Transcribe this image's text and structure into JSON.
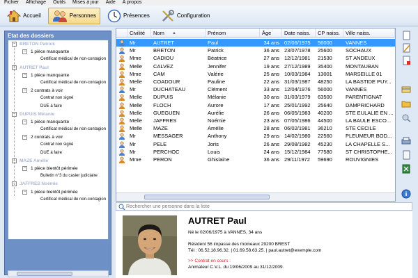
{
  "menu": [
    "Fichier",
    "Affichage",
    "Outils",
    "Mises à jour",
    "Aide",
    "A propos"
  ],
  "toolbar": [
    {
      "label": "Accueil",
      "icon": "home-icon",
      "active": false
    },
    {
      "label": "Personnes",
      "icon": "people-icon",
      "active": true
    },
    {
      "label": "Présences",
      "icon": "clock-icon",
      "active": false
    },
    {
      "label": "Configuration",
      "icon": "tools-icon",
      "active": false
    }
  ],
  "left_panel": {
    "title": "Etat des dossiers",
    "tree": [
      {
        "level": 0,
        "text": "BRETON Patrick",
        "blur": true
      },
      {
        "level": 1,
        "text": "1 pièce manquante"
      },
      {
        "level": 2,
        "text": "Certificat médical de non-contagion"
      },
      {
        "level": 0,
        "text": "AUTRET Paul",
        "blur": true
      },
      {
        "level": 1,
        "text": "1 pièce manquante"
      },
      {
        "level": 2,
        "text": "Certificat médical de non-contagion"
      },
      {
        "level": 1,
        "text": "2 contrats à voir"
      },
      {
        "level": 2,
        "text": "Contrat non signé"
      },
      {
        "level": 2,
        "text": "DUE à faire"
      },
      {
        "level": 0,
        "text": "DUPUIS Mélanie",
        "blur": true
      },
      {
        "level": 1,
        "text": "1 pièce manquante"
      },
      {
        "level": 2,
        "text": "Certificat médical de non-contagion"
      },
      {
        "level": 1,
        "text": "2 contrats à voir"
      },
      {
        "level": 2,
        "text": "Contrat non signé"
      },
      {
        "level": 2,
        "text": "DUE à faire"
      },
      {
        "level": 0,
        "text": "MAZE Amélie",
        "blur": true
      },
      {
        "level": 1,
        "text": "1 pièce bientôt périmée"
      },
      {
        "level": 2,
        "text": "Bulletin n°3 du casier judiciaire"
      },
      {
        "level": 0,
        "text": "JAFFRES Noémie",
        "blur": true
      },
      {
        "level": 1,
        "text": "1 pièce bientôt périmée"
      },
      {
        "level": 2,
        "text": "Certificat médical de non-contagion"
      }
    ]
  },
  "grid": {
    "columns": [
      "Civilité",
      "Nom",
      "Prénom",
      "Âge",
      "Date naiss.",
      "CP naiss.",
      "Ville naiss."
    ],
    "sort_indicator": "▲",
    "selected_index": 0,
    "rows": [
      {
        "sex": "m",
        "civ": "Mr",
        "nom": "AUTRET",
        "prenom": "Paul",
        "age": "34 ans",
        "date": "02/06/1975",
        "cp": "56000",
        "ville": "VANNES"
      },
      {
        "sex": "m",
        "civ": "Mr",
        "nom": "BRETON",
        "prenom": "Patrick",
        "age": "36 ans",
        "date": "23/07/1978",
        "cp": "25600",
        "ville": "SOCHAUX"
      },
      {
        "sex": "f",
        "civ": "Mme",
        "nom": "CADIOU",
        "prenom": "Béatrice",
        "age": "27 ans",
        "date": "12/12/1981",
        "cp": "21530",
        "ville": "ST ANDEUX"
      },
      {
        "sex": "f",
        "civ": "Melle",
        "nom": "CALVEZ",
        "prenom": "Jennifer",
        "age": "19 ans",
        "date": "27/12/1989",
        "cp": "35400",
        "ville": "MONTAUBAN"
      },
      {
        "sex": "f",
        "civ": "Mme",
        "nom": "CAM",
        "prenom": "Valérie",
        "age": "25 ans",
        "date": "10/03/1984",
        "cp": "13001",
        "ville": "MARSEILLE 01"
      },
      {
        "sex": "f",
        "civ": "Melle",
        "nom": "COADOUR",
        "prenom": "Pauline",
        "age": "22 ans",
        "date": "31/03/1987",
        "cp": "48250",
        "ville": "LA BASTIDE PUY..."
      },
      {
        "sex": "m",
        "civ": "Mr",
        "nom": "DUCHATEAU",
        "prenom": "Clément",
        "age": "33 ans",
        "date": "12/04/1976",
        "cp": "56000",
        "ville": "VANNES"
      },
      {
        "sex": "f",
        "civ": "Melle",
        "nom": "DUPUIS",
        "prenom": "Mélanie",
        "age": "30 ans",
        "date": "31/03/1979",
        "cp": "63500",
        "ville": "PARENTIGNAT"
      },
      {
        "sex": "f",
        "civ": "Melle",
        "nom": "FLOCH",
        "prenom": "Aurore",
        "age": "17 ans",
        "date": "25/01/1992",
        "cp": "25640",
        "ville": "DAMPRICHARD"
      },
      {
        "sex": "f",
        "civ": "Melle",
        "nom": "GUEGUEN",
        "prenom": "Aurélie",
        "age": "26 ans",
        "date": "06/05/1983",
        "cp": "40200",
        "ville": "STE EULALIE EN ..."
      },
      {
        "sex": "f",
        "civ": "Melle",
        "nom": "JAFFRES",
        "prenom": "Noémie",
        "age": "23 ans",
        "date": "07/05/1986",
        "cp": "44500",
        "ville": "LA BAULE ESCO..."
      },
      {
        "sex": "f",
        "civ": "Melle",
        "nom": "MAZE",
        "prenom": "Amélie",
        "age": "28 ans",
        "date": "06/02/1981",
        "cp": "36210",
        "ville": "STE CECILE"
      },
      {
        "sex": "m",
        "civ": "Mr",
        "nom": "MESSAGER",
        "prenom": "Anthony",
        "age": "29 ans",
        "date": "14/02/1980",
        "cp": "22560",
        "ville": "PLEUMEUR BOD..."
      },
      {
        "sex": "m",
        "civ": "Mr",
        "nom": "PELE",
        "prenom": "Joris",
        "age": "26 ans",
        "date": "29/08/1982",
        "cp": "45230",
        "ville": "LA CHAPELLE S..."
      },
      {
        "sex": "m",
        "civ": "Mr",
        "nom": "PERCHOC",
        "prenom": "Louis",
        "age": "24 ans",
        "date": "15/12/1984",
        "cp": "77580",
        "ville": "ST CHRISTOPHE..."
      },
      {
        "sex": "f",
        "civ": "Mme",
        "nom": "PERON",
        "prenom": "Ghislaine",
        "age": "36 ans",
        "date": "29/11/1972",
        "cp": "59690",
        "ville": "ROUVIGNIES"
      }
    ]
  },
  "search": {
    "placeholder": "Rechercher une personne dans la liste"
  },
  "detail": {
    "name": "AUTRET Paul",
    "birth": "Né le 02/06/1975 à VANNES, 34 ans",
    "address": "Résident 56 impasse des moineaux 29200 BREST",
    "contact": "Tél : 06.52.18.96.32. | 01.69.58.63.25. | paul.autret@exemple.com",
    "contract_label": ">> Contrat en cours :",
    "contract_text": "Animateur C.V.L. du 19/06/2009 au 31/12/2009."
  },
  "colors": {
    "selection": "#3399ff",
    "panel": "#6d90c7",
    "red": "#e02020"
  }
}
